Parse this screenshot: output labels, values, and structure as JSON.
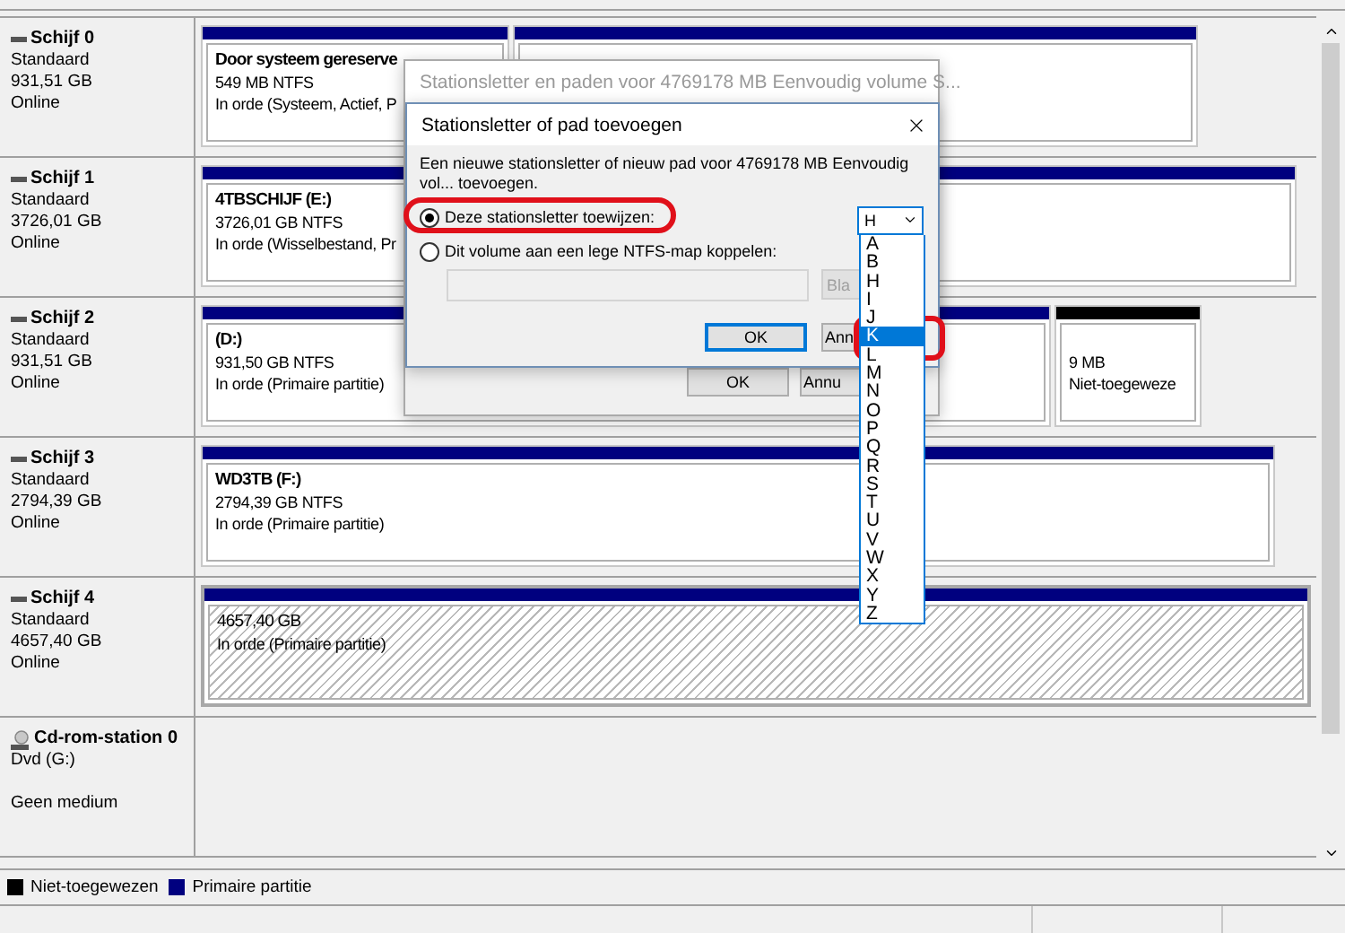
{
  "disks": [
    {
      "kind": "disk",
      "name": "Schijf 0",
      "type": "Standaard",
      "size": "931,51 GB",
      "status": "Online",
      "partitions": [
        {
          "kind": "primary",
          "title": "Door systeem gereserve",
          "lines": [
            "549 MB NTFS",
            "In orde (Systeem, Actief, P"
          ],
          "selected": false
        },
        {
          "kind": "primary",
          "selected": false
        }
      ]
    },
    {
      "kind": "disk",
      "name": "Schijf 1",
      "type": "Standaard",
      "size": "3726,01 GB",
      "status": "Online",
      "partitions": [
        {
          "kind": "primary",
          "title": "4TBSCHIJF  (E:)",
          "lines": [
            "3726,01 GB NTFS",
            "In orde (Wisselbestand, Pr"
          ],
          "selected": false
        }
      ]
    },
    {
      "kind": "disk",
      "name": "Schijf 2",
      "type": "Standaard",
      "size": "931,51 GB",
      "status": "Online",
      "partitions": [
        {
          "kind": "primary",
          "title": "(D:)",
          "lines": [
            "931,50 GB NTFS",
            "In orde (Primaire partitie)"
          ],
          "selected": false
        },
        {
          "kind": "unallocated",
          "lines": [
            "9 MB",
            "Niet-toegeweze"
          ],
          "selected": false
        }
      ]
    },
    {
      "kind": "disk",
      "name": "Schijf 3",
      "type": "Standaard",
      "size": "2794,39 GB",
      "status": "Online",
      "partitions": [
        {
          "kind": "primary",
          "title": "WD3TB  (F:)",
          "lines": [
            "2794,39 GB NTFS",
            "In orde (Primaire partitie)"
          ],
          "selected": false
        }
      ]
    },
    {
      "kind": "disk",
      "name": "Schijf 4",
      "type": "Standaard",
      "size": "4657,40 GB",
      "status": "Online",
      "partitions": [
        {
          "kind": "primary",
          "lines": [
            "4657,40 GB",
            "In orde (Primaire partitie)"
          ],
          "selected": true
        }
      ]
    },
    {
      "kind": "cdrom",
      "name": "Cd-rom-station 0",
      "type": "Dvd (G:)",
      "status": "Geen medium"
    }
  ],
  "legend": [
    {
      "label": "Niet-toegewezen",
      "color": "#000000"
    },
    {
      "label": "Primaire partitie",
      "color": "#00007f"
    }
  ],
  "back_dialog": {
    "title": "Stationsletter en paden voor 4769178 MB  Eenvoudig volume S...",
    "active": false,
    "buttons": [
      {
        "label": "OK"
      },
      {
        "label": "Annu"
      }
    ]
  },
  "front_dialog": {
    "title": "Stationsletter of pad toevoegen",
    "active": true,
    "description": "Een nieuwe stationsletter of nieuw pad voor 4769178 MB  Eenvoudig vol... toevoegen.",
    "options": [
      {
        "label": "Deze stationsletter toewijzen:",
        "selected": true,
        "circled": true
      },
      {
        "label": "Dit volume aan een lege NTFS-map koppelen:",
        "selected": false,
        "circled": false
      }
    ],
    "dropdown": {
      "value": "H",
      "expanded": true,
      "selection_circled": true
    },
    "path_field": {
      "disabled": true
    },
    "browse_button": {
      "label": "Bla",
      "disabled": true
    },
    "buttons": [
      {
        "label": "OK",
        "focused": true
      },
      {
        "label": "Ann",
        "focused": false
      }
    ],
    "list": [
      {
        "label": "A",
        "selected": false
      },
      {
        "label": "B",
        "selected": false
      },
      {
        "label": "H",
        "selected": false
      },
      {
        "label": "I",
        "selected": false
      },
      {
        "label": "J",
        "selected": false
      },
      {
        "label": "K",
        "selected": true
      },
      {
        "label": "L",
        "selected": false
      },
      {
        "label": "M",
        "selected": false
      },
      {
        "label": "N",
        "selected": false
      },
      {
        "label": "O",
        "selected": false
      },
      {
        "label": "P",
        "selected": false
      },
      {
        "label": "Q",
        "selected": false
      },
      {
        "label": "R",
        "selected": false
      },
      {
        "label": "S",
        "selected": false
      },
      {
        "label": "T",
        "selected": false
      },
      {
        "label": "U",
        "selected": false
      },
      {
        "label": "V",
        "selected": false
      },
      {
        "label": "W",
        "selected": false
      },
      {
        "label": "X",
        "selected": false
      },
      {
        "label": "Y",
        "selected": false
      },
      {
        "label": "Z",
        "selected": false
      }
    ]
  }
}
